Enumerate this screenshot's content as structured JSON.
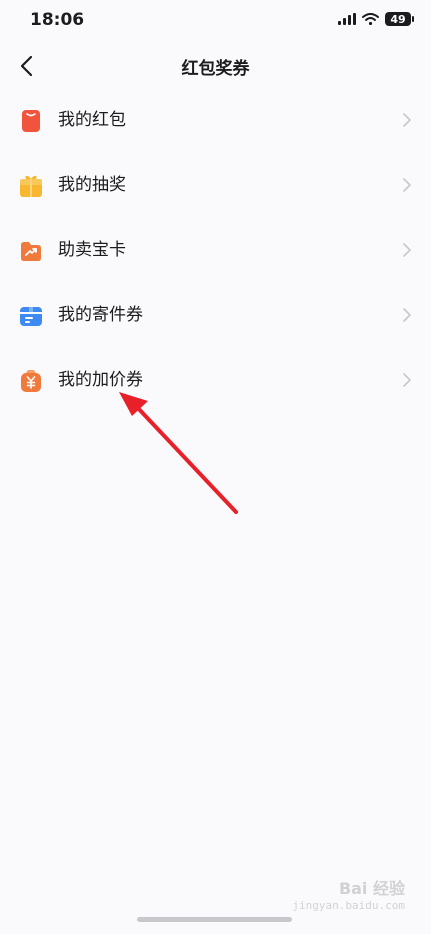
{
  "status_bar": {
    "time": "18:06",
    "battery": "49"
  },
  "header": {
    "title": "红包奖券"
  },
  "menu": {
    "items": [
      {
        "label": "我的红包",
        "icon": "red-envelope-icon",
        "color": "#F0543C"
      },
      {
        "label": "我的抽奖",
        "icon": "gift-box-icon",
        "color": "#F7B731"
      },
      {
        "label": "助卖宝卡",
        "icon": "trend-card-icon",
        "color": "#F07A3C"
      },
      {
        "label": "我的寄件券",
        "icon": "parcel-icon",
        "color": "#3D8BF2"
      },
      {
        "label": "我的加价券",
        "icon": "yuan-bag-icon",
        "color": "#F07A3C"
      }
    ]
  },
  "annotation": {
    "color": "#E8202A"
  },
  "watermark": {
    "brand": "Bai 经验",
    "sub": "jingyan.baidu.com"
  }
}
